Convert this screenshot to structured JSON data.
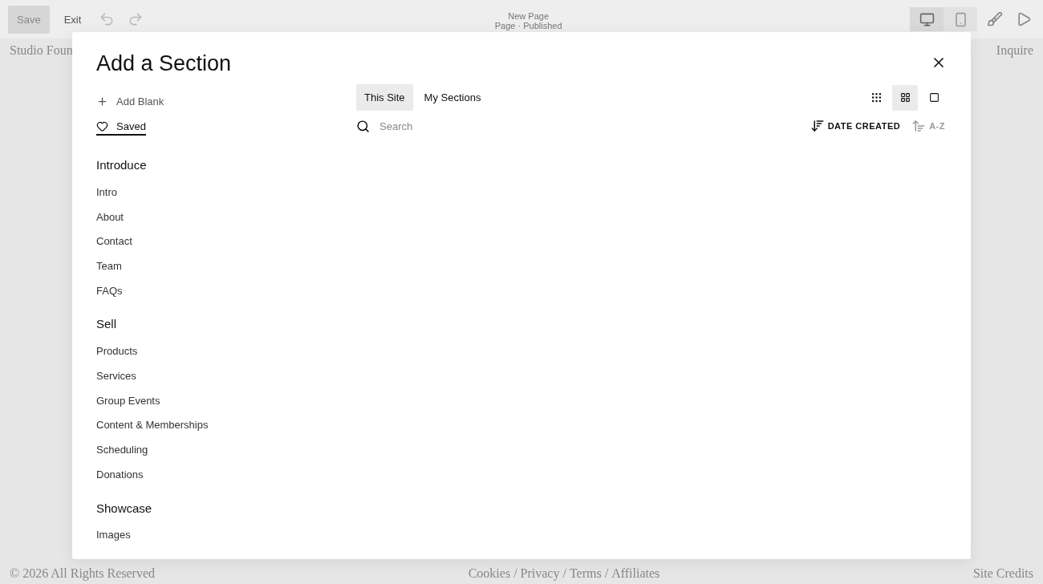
{
  "toolbar": {
    "save": {
      "label": "Save",
      "disabled": true
    },
    "exit": "Exit",
    "page_title": "New Page",
    "page_status": "Page · Published",
    "devices": [
      {
        "kind": "desktop",
        "selected": true
      },
      {
        "kind": "mobile",
        "selected": false
      }
    ]
  },
  "site": {
    "brand": "Studio Foun",
    "nav": "Inquire",
    "footer": {
      "copyright": "© 2026 All Rights Reserved",
      "links": [
        "Cookies",
        "Privacy",
        "Terms",
        "Affiliates"
      ],
      "separator": "/",
      "credits": "Site Credits"
    }
  },
  "dialog": {
    "title": "Add a Section",
    "actions": [
      {
        "kind": "add",
        "label": "Add Blank",
        "selected": false
      },
      {
        "kind": "heart",
        "label": "Saved",
        "selected": true
      }
    ],
    "groups": [
      {
        "heading": "Introduce",
        "items": [
          "Intro",
          "About",
          "Contact",
          "Team",
          "FAQs"
        ]
      },
      {
        "heading": "Sell",
        "items": [
          "Products",
          "Services",
          "Group Events",
          "Content & Memberships",
          "Scheduling",
          "Donations"
        ]
      },
      {
        "heading": "Showcase",
        "items": [
          "Images"
        ]
      }
    ],
    "tabs": [
      {
        "label": "This Site",
        "selected": true
      },
      {
        "label": "My Sections",
        "selected": false
      }
    ],
    "views": [
      {
        "kind": "small",
        "selected": false
      },
      {
        "kind": "medium",
        "selected": true
      },
      {
        "kind": "large",
        "selected": false
      }
    ],
    "search": {
      "placeholder": "Search"
    },
    "sorts": [
      {
        "kind": "down",
        "label": "DATE CREATED",
        "selected": true
      },
      {
        "kind": "up",
        "label": "A-Z",
        "selected": false
      }
    ]
  }
}
